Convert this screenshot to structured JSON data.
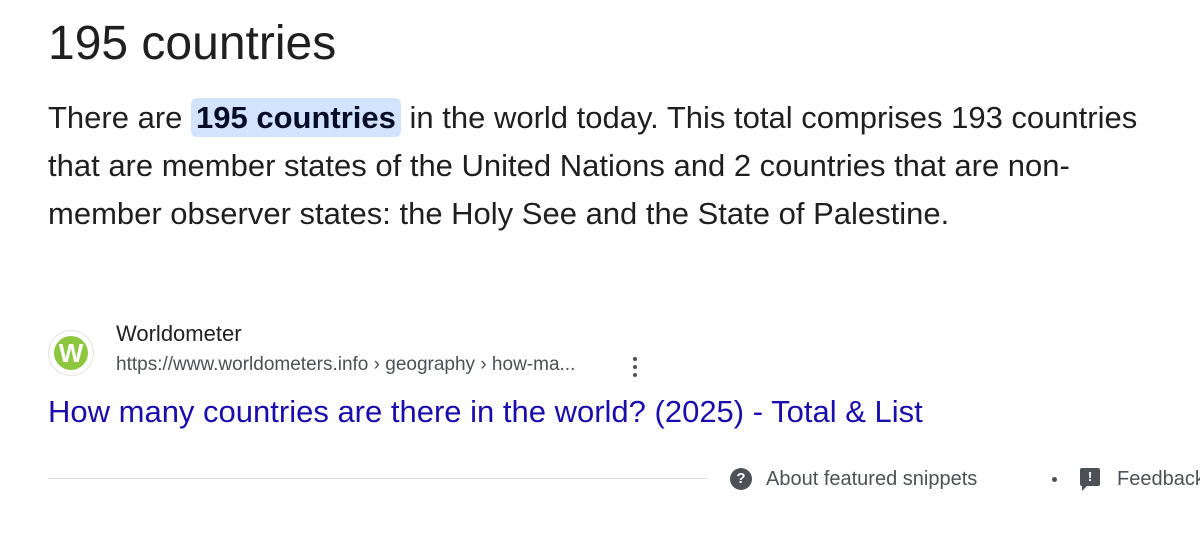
{
  "featured_snippet": {
    "title": "195 countries",
    "text": {
      "before": "There are ",
      "highlight": "195 countries",
      "after": " in the world today. This total comprises 193 countries that are member states of the United Nations and 2 countries that are non-member observer states: the Holy See and the State of Palestine."
    },
    "source": {
      "favicon_letter": "W",
      "favicon_color": "#8dc63f",
      "site_name": "Worldometer",
      "url": "https://www.worldometers.info › geography › how-ma...",
      "more_icon": "vertical-dots-icon"
    },
    "result_link": {
      "label": "How many countries are there in the world? (2025) - Total & List",
      "color": "#1a0dab"
    },
    "footer": {
      "about_label": "About featured snippets",
      "about_icon": "help-circle-icon",
      "separator": "•",
      "feedback_label": "Feedback",
      "feedback_icon": "feedback-icon"
    },
    "highlight_color": "#d3e3fd"
  }
}
